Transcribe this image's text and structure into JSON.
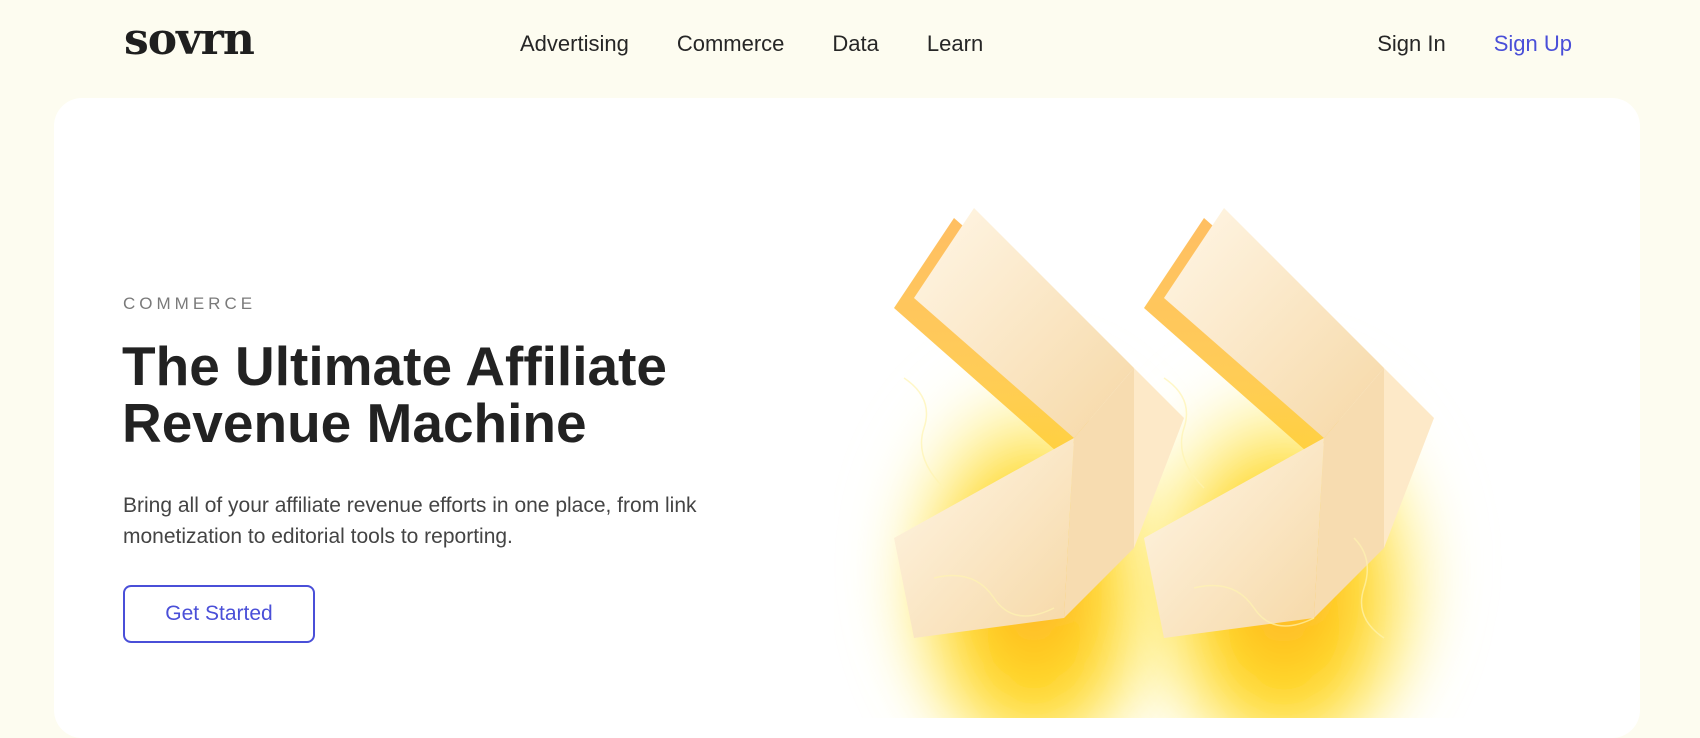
{
  "header": {
    "logo_text": "sovrn",
    "nav": [
      {
        "label": "Advertising"
      },
      {
        "label": "Commerce"
      },
      {
        "label": "Data"
      },
      {
        "label": "Learn"
      }
    ],
    "sign_in_label": "Sign In",
    "sign_up_label": "Sign Up"
  },
  "hero": {
    "eyebrow": "COMMERCE",
    "headline": "The Ultimate Affiliate Revenue Machine",
    "subtext": "Bring all of your affiliate revenue efforts in one place, from link monetization to editorial tools to reporting.",
    "cta_label": "Get Started",
    "illustration_icon": "double-chevron-right-icon"
  },
  "colors": {
    "page_bg": "#fdfcf0",
    "card_bg": "#ffffff",
    "accent": "#4a4fd8",
    "glow_yellow": "#ffd400",
    "glow_orange": "#ffa726",
    "text_dark": "#222222"
  }
}
